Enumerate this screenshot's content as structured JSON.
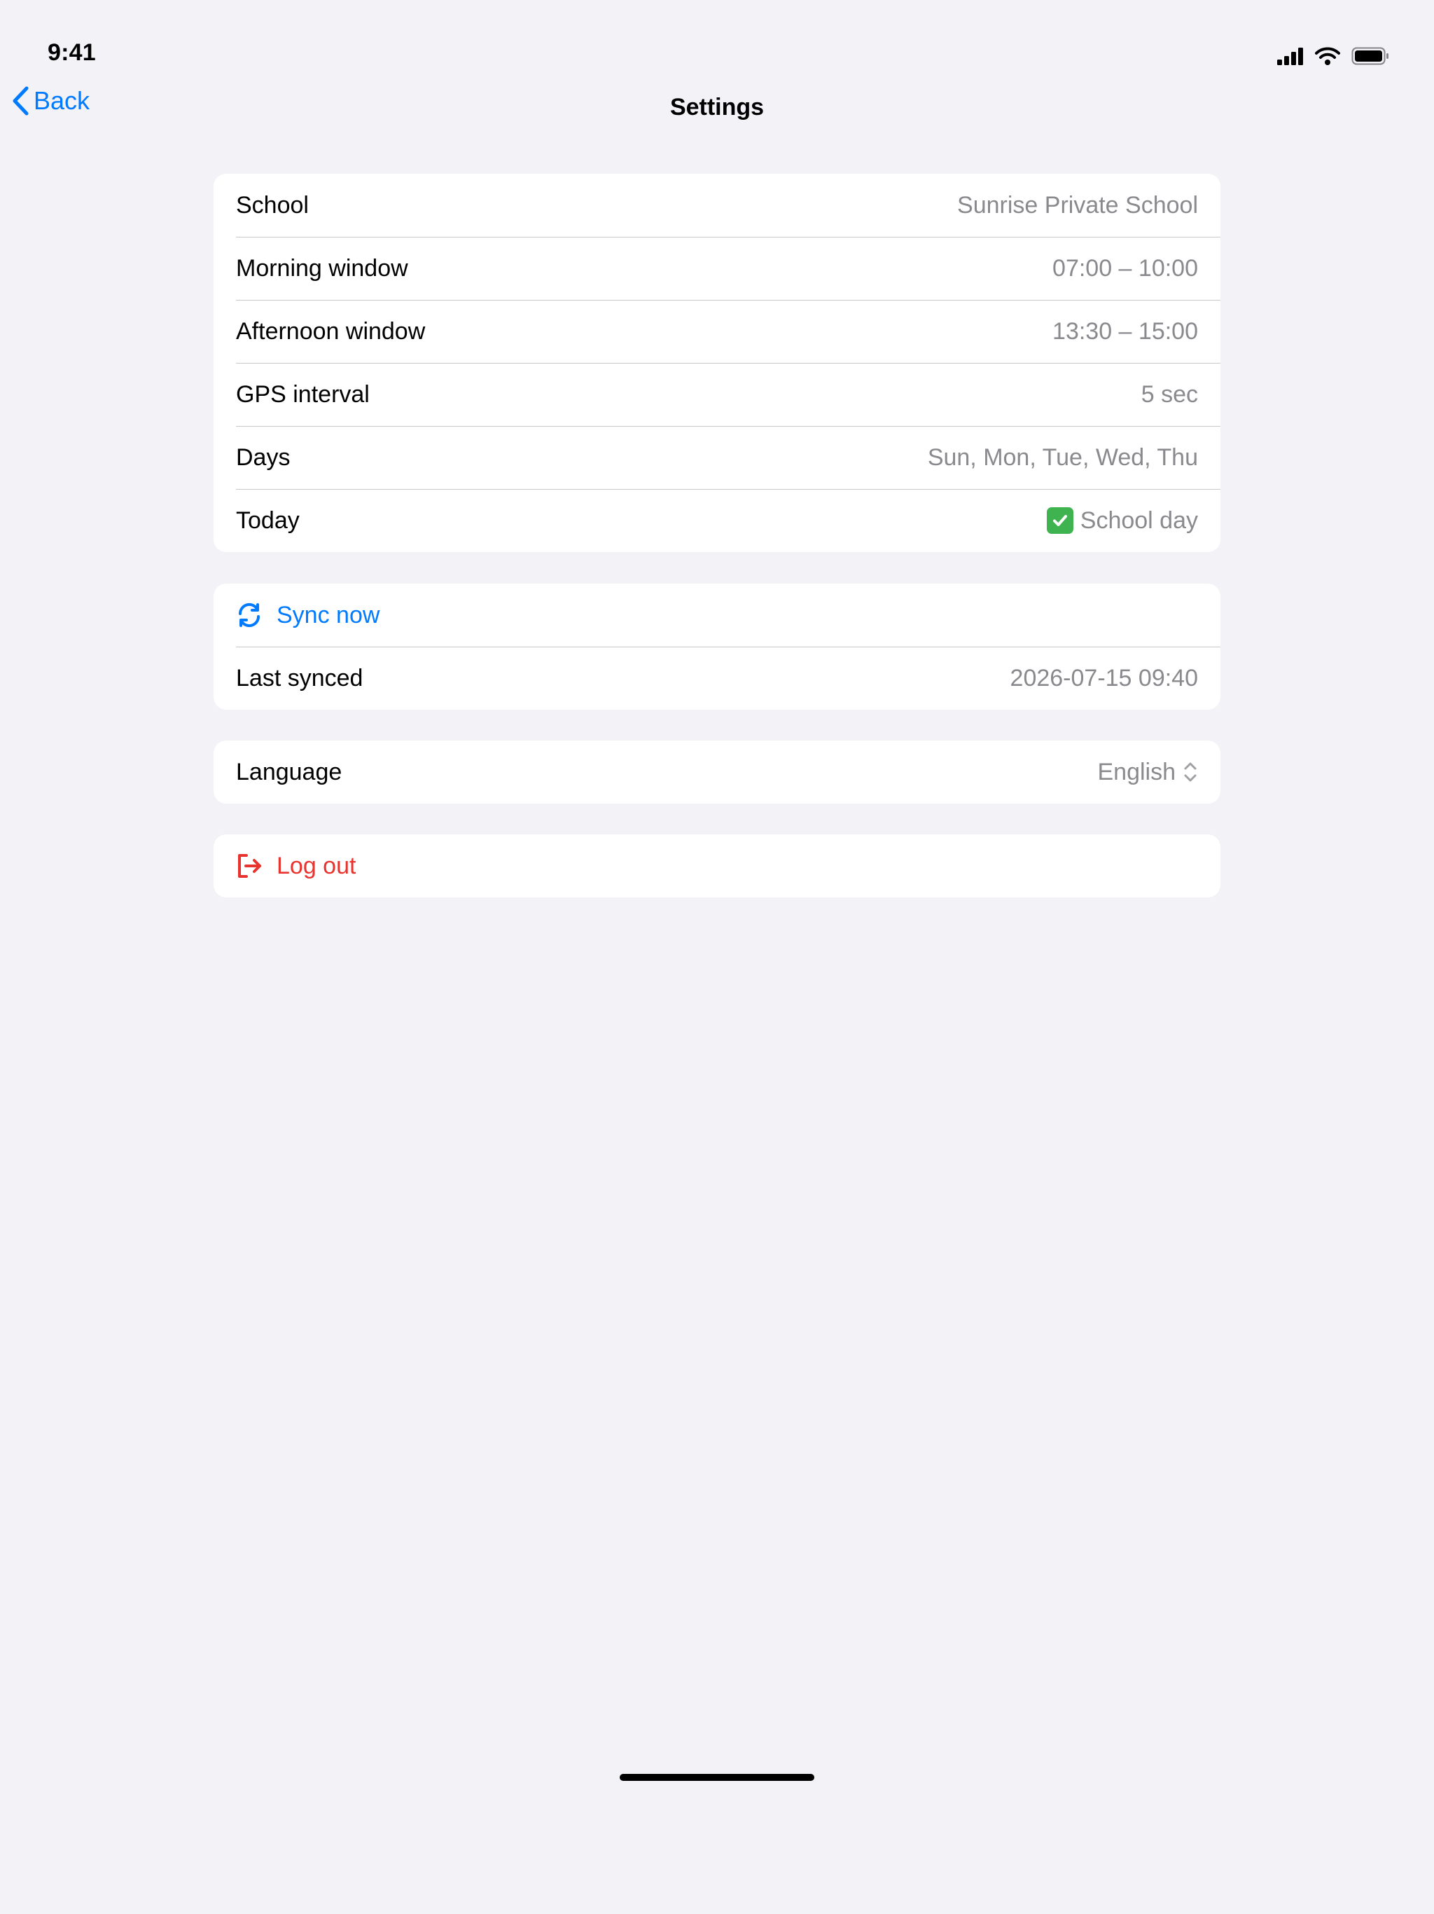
{
  "status_bar": {
    "time": "9:41"
  },
  "nav": {
    "back_label": "Back",
    "title": "Settings"
  },
  "school_group": {
    "rows": [
      {
        "label": "School",
        "value": "Sunrise Private School"
      },
      {
        "label": "Morning window",
        "value": "07:00 – 10:00"
      },
      {
        "label": "Afternoon window",
        "value": "13:30 – 15:00"
      },
      {
        "label": "GPS interval",
        "value": "5 sec"
      },
      {
        "label": "Days",
        "value": "Sun, Mon, Tue, Wed, Thu"
      },
      {
        "label": "Today",
        "value": "School day"
      }
    ]
  },
  "sync_group": {
    "sync_label": "Sync now",
    "last_synced_label": "Last synced",
    "last_synced_value": "2026-07-15 09:40"
  },
  "language_group": {
    "label": "Language",
    "value": "English"
  },
  "logout_group": {
    "label": "Log out"
  },
  "colors": {
    "background": "#f2f2f7",
    "accent": "#007aff",
    "destructive": "#e8332f",
    "secondary_text": "#8a8a8e",
    "check": "#3fb34f"
  },
  "icons": {
    "today_status": "check-mark-icon",
    "sync": "sync-icon",
    "language_picker": "chevron-up-down-icon",
    "logout": "logout-icon",
    "back": "chevron-left-icon"
  }
}
